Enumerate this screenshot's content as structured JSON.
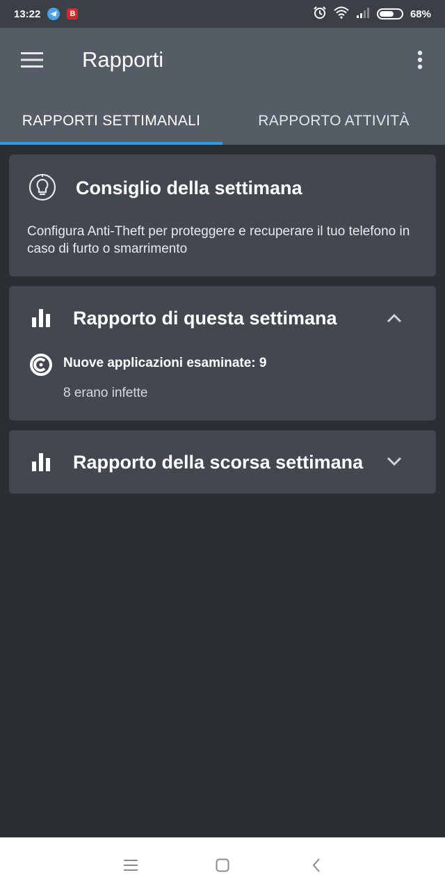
{
  "status_bar": {
    "time": "13:22",
    "notification_badge": "B",
    "battery": "68%",
    "battery_level": 0.68,
    "icons": [
      "telegram-icon",
      "alarm-icon",
      "wifi-icon",
      "signal-icon",
      "battery-icon"
    ]
  },
  "app_bar": {
    "title": "Rapporti",
    "menu_icon": "hamburger-menu-icon",
    "overflow_icon": "more-vert-icon"
  },
  "tabs": [
    {
      "label": "RAPPORTI SETTIMANALI",
      "active": true
    },
    {
      "label": "RAPPORTO ATTIVITÀ",
      "active": false
    }
  ],
  "cards": {
    "tip": {
      "icon": "lightbulb-icon",
      "title": "Consiglio della settimana",
      "body": "Configura Anti-Theft per proteggere e recuperare il tuo telefono in caso di furto o smarrimento"
    },
    "this_week": {
      "icon": "bar-chart-icon",
      "title": "Rapporto di questa settimana",
      "toggle_icon": "chevron-up-icon",
      "stat_icon": "scan-app-icon",
      "stat_label": "Nuove applicazioni esaminate: 9",
      "stat_sub": "8 erano infette"
    },
    "last_week": {
      "icon": "bar-chart-icon",
      "title": "Rapporto della scorsa settimana",
      "toggle_icon": "chevron-down-icon"
    }
  },
  "nav_bar": {
    "buttons": [
      "menu-icon",
      "home-icon",
      "back-icon"
    ]
  },
  "colors": {
    "app_bar": "#555c66",
    "background": "#2b2e33",
    "card": "#434850",
    "tab_indicator": "#2c9be8"
  }
}
